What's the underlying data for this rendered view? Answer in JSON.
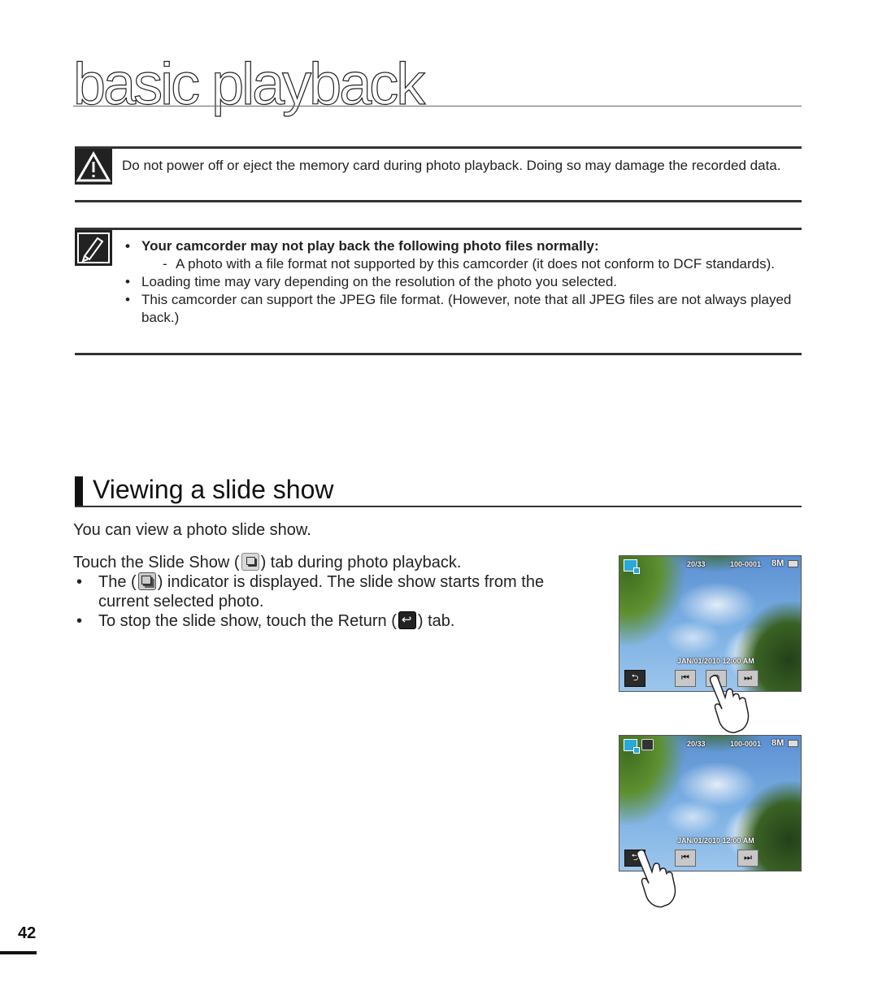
{
  "page": {
    "title": "basic playback",
    "page_number": "42"
  },
  "warning": {
    "icon": "warning-triangle-icon",
    "text": "Do not power off or eject the memory card during photo playback. Doing so may damage the recorded data."
  },
  "note": {
    "icon": "note-pencil-icon",
    "items": [
      {
        "text": "Your camcorder may not play back the following photo files normally:",
        "bold": true,
        "sub_items": [
          "A photo with a file format not supported by this camcorder (it does not conform to DCF standards)."
        ]
      },
      {
        "text": "Loading time may vary depending on the resolution of the photo you selected."
      },
      {
        "text": "This camcorder can support the JPEG file format. (However, note that all JPEG files are not always played back.)"
      }
    ]
  },
  "section": {
    "title": "Viewing a slide show",
    "intro": "You can view a photo slide show.",
    "step_prefix": "Touch the Slide Show (",
    "step_suffix": ") tab during photo playback.",
    "bullet1_prefix": "The (",
    "bullet1_suffix": ") indicator is displayed. The slide show starts from the current selected photo.",
    "bullet2_prefix": "To stop the slide show, touch the Return (",
    "bullet2_suffix": ") tab.",
    "icons": {
      "slideshow_tab": "slideshow-icon",
      "slideshow_indicator": "slideshow-indicator-icon",
      "return_tab": "return-icon"
    }
  },
  "screens": [
    {
      "counter": "20/33",
      "file_number": "100-0001",
      "resolution": "8M",
      "date": "JAN/01/2010  12:00 AM",
      "slideshow_indicator_visible": false,
      "buttons": {
        "return": "⮌",
        "prev": "⏮",
        "slideshow": "⧉",
        "next": "⏭"
      }
    },
    {
      "counter": "20/33",
      "file_number": "100-0001",
      "resolution": "8M",
      "date": "JAN/01/2010  12:00 AM",
      "slideshow_indicator_visible": true,
      "buttons": {
        "return": "⮌",
        "prev": "⏮",
        "next": "⏭"
      }
    }
  ]
}
